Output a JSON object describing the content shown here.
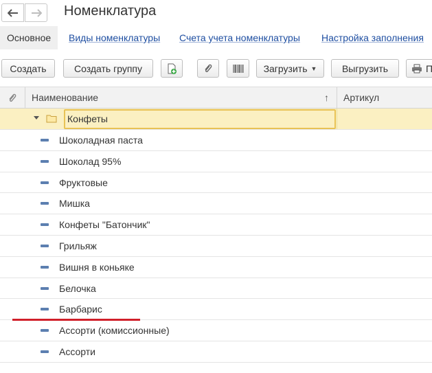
{
  "window": {
    "title": "Номенклатура"
  },
  "nav": {
    "back_icon": "arrow-left-icon",
    "forward_icon": "arrow-right-icon"
  },
  "navpanel": {
    "items": [
      {
        "label": "Основное",
        "active": true
      },
      {
        "label": "Виды номенклатуры",
        "active": false
      },
      {
        "label": "Счета учета номенклатуры",
        "active": false
      },
      {
        "label": "Настройка заполнения",
        "active": false
      }
    ]
  },
  "toolbar": {
    "create_label": "Создать",
    "create_group_label": "Создать группу",
    "copy_icon": "create-copy-icon",
    "attach_icon": "paperclip-icon",
    "barcode_icon": "barcode-icon",
    "load_label": "Загрузить",
    "unload_label": "Выгрузить",
    "print_label": "П",
    "print_icon": "printer-icon"
  },
  "table": {
    "columns": {
      "attach_icon": "paperclip-icon",
      "name": "Наименование",
      "sort_indicator": "↑",
      "article": "Артикул"
    },
    "group": {
      "name": "Конфеты",
      "icon": "folder-icon"
    },
    "items": [
      "Шоколадная паста",
      "Шоколад 95%",
      "Фруктовые",
      "Мишка",
      "Конфеты \"Батончик\"",
      "Грильяж",
      "Вишня в коньяке",
      "Белочка",
      "Барбарис",
      "Ассорти (комиссионные)",
      "Ассорти"
    ]
  },
  "colors": {
    "link": "#1e4ea1",
    "group_row_bg": "#fbf0c2",
    "group_row_border": "#e8c255",
    "annotation_underline": "#d0202a",
    "item_icon": "#5c7fb0"
  }
}
